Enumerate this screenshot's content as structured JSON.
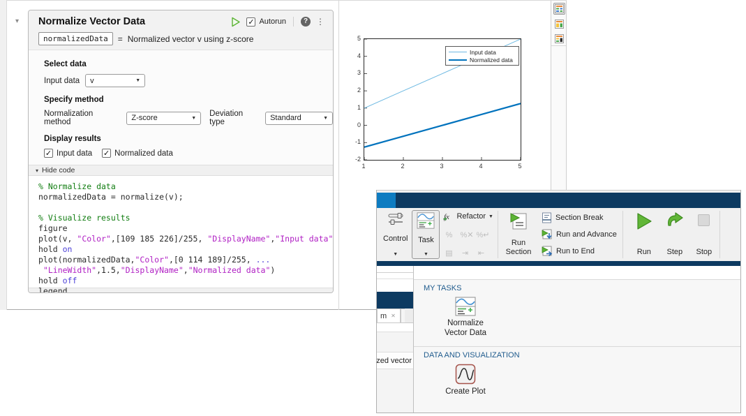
{
  "main_window": {
    "task": {
      "title": "Normalize Vector Data",
      "autorun_label": "Autorun",
      "output_variable": "normalizedData",
      "equals": "=",
      "summary": "Normalized vector v using z-score",
      "select_data_heading": "Select data",
      "input_data_label": "Input data",
      "input_data_value": "v",
      "specify_method_heading": "Specify method",
      "normalization_method_label": "Normalization method",
      "normalization_method_value": "Z-score",
      "deviation_type_label": "Deviation type",
      "deviation_type_value": "Standard",
      "display_results_heading": "Display results",
      "checkboxes": [
        {
          "label": "Input data",
          "checked": true
        },
        {
          "label": "Normalized data",
          "checked": true
        }
      ],
      "hide_code_label": "Hide code",
      "code_lines": [
        [
          {
            "t": "% Normalize data",
            "s": "c"
          }
        ],
        [
          {
            "t": "normalizedData = normalize(v);",
            "s": "p"
          }
        ],
        [],
        [
          {
            "t": "% Visualize results",
            "s": "c"
          }
        ],
        [
          {
            "t": "figure",
            "s": "p"
          }
        ],
        [
          {
            "t": "plot(v, ",
            "s": "p"
          },
          {
            "t": "\"Color\"",
            "s": "s"
          },
          {
            "t": ",[109 185 226]/255, ",
            "s": "p"
          },
          {
            "t": "\"DisplayName\"",
            "s": "s"
          },
          {
            "t": ",",
            "s": "p"
          },
          {
            "t": "\"Input data\"",
            "s": "s"
          },
          {
            "t": ")",
            "s": "p"
          }
        ],
        [
          {
            "t": "hold ",
            "s": "p"
          },
          {
            "t": "on",
            "s": "k"
          }
        ],
        [
          {
            "t": "plot(normalizedData,",
            "s": "p"
          },
          {
            "t": "\"Color\"",
            "s": "s"
          },
          {
            "t": ",[0 114 189]/255, ",
            "s": "p"
          },
          {
            "t": "...",
            "s": "k"
          }
        ],
        [
          {
            "t": " ",
            "s": "p"
          },
          {
            "t": "\"LineWidth\"",
            "s": "s"
          },
          {
            "t": ",1.5,",
            "s": "p"
          },
          {
            "t": "\"DisplayName\"",
            "s": "s"
          },
          {
            "t": ",",
            "s": "p"
          },
          {
            "t": "\"Normalized data\"",
            "s": "s"
          },
          {
            "t": ")",
            "s": "p"
          }
        ],
        [
          {
            "t": "hold ",
            "s": "p"
          },
          {
            "t": "off",
            "s": "k"
          }
        ],
        [
          {
            "t": "legend",
            "s": "p"
          }
        ]
      ]
    }
  },
  "chart_data": {
    "type": "line",
    "x": [
      1,
      2,
      3,
      4,
      5
    ],
    "series": [
      {
        "name": "Input data",
        "values": [
          1,
          2,
          3,
          4,
          5
        ],
        "color": "#6db9e2",
        "width": 1
      },
      {
        "name": "Normalized data",
        "values": [
          -1.2649,
          -0.6325,
          0,
          0.6325,
          1.2649
        ],
        "color": "#0072bd",
        "width": 2.2
      }
    ],
    "xlim": [
      1,
      5
    ],
    "ylim": [
      -2,
      5
    ],
    "xticks": [
      1,
      2,
      3,
      4,
      5
    ],
    "yticks": [
      -2,
      -1,
      0,
      1,
      2,
      3,
      4,
      5
    ],
    "title": "",
    "xlabel": "",
    "ylabel": "",
    "grid": false,
    "legend_position": "upper-right-inside"
  },
  "overlay_window": {
    "ribbon": {
      "control_label": "Control",
      "task_label": "Task",
      "refactor_label": "Refactor",
      "run_section_label": "Run Section",
      "section_break_label": "Section Break",
      "run_and_advance_label": "Run and Advance",
      "run_to_end_label": "Run to End",
      "run_label": "Run",
      "step_label": "Step",
      "stop_label": "Stop",
      "comment_glyph": "%",
      "uncomment_glyph": "%✕",
      "wrap_comment_glyph": "%↵",
      "doc_glyph": "▤",
      "indent_glyph": "⇥",
      "outdent_glyph": "⇤"
    },
    "gallery": {
      "sections": [
        {
          "title": "MY TASKS",
          "items": [
            {
              "label_lines": [
                "Normalize",
                "Vector Data"
              ]
            }
          ]
        },
        {
          "title": "DATA AND VISUALIZATION",
          "items": [
            {
              "label_lines": [
                "Create Plot"
              ]
            }
          ]
        }
      ]
    }
  },
  "background_fragments": {
    "tab_label": "m",
    "partial_code_text": "zed vector"
  }
}
